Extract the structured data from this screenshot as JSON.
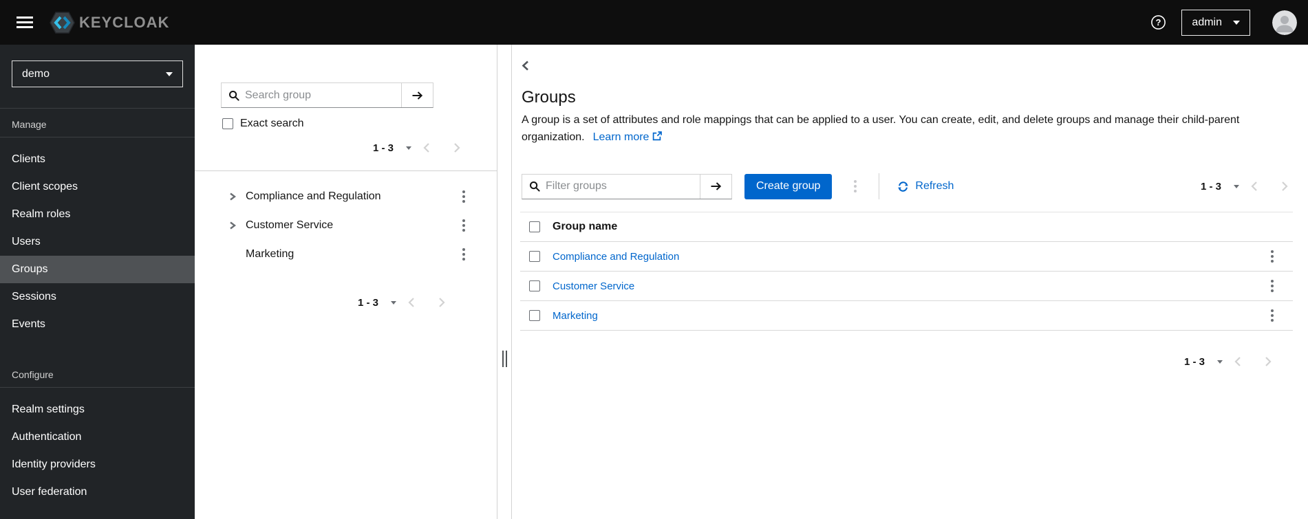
{
  "colors": {
    "accent": "#0066cc",
    "link": "#0066cc",
    "masthead_bg": "#0e0e0e",
    "sidebar_bg": "#212427",
    "sidebar_selected_bg": "#4f5255",
    "border": "#d2d2d2"
  },
  "icons": {
    "menu": "hamburger",
    "brand": "keycloak-hexagon-chevrons",
    "help": "question-circle",
    "user": "avatar-silhouette",
    "search": "magnifier",
    "go": "arrow-right",
    "expand": "chevron-right",
    "back": "chevron-left",
    "kebab": "three-dots-vertical",
    "refresh": "sync-arrows",
    "external": "external-link",
    "caret": "caret-down"
  },
  "masthead": {
    "brand": "KEYCLOAK",
    "user": "admin"
  },
  "sidebar": {
    "realm": "demo",
    "manage": {
      "label": "Manage",
      "items": [
        "Clients",
        "Client scopes",
        "Realm roles",
        "Users",
        "Groups",
        "Sessions",
        "Events"
      ]
    },
    "configure": {
      "label": "Configure",
      "items": [
        "Realm settings",
        "Authentication",
        "Identity providers",
        "User federation"
      ]
    },
    "selected_item": "Groups"
  },
  "tree": {
    "search_placeholder": "Search group",
    "exact_search": "Exact search",
    "pagination_top": "1 - 3",
    "pagination_bottom": "1 - 3",
    "items": [
      "Compliance and Regulation",
      "Customer Service",
      "Marketing"
    ]
  },
  "main": {
    "title": "Groups",
    "description": "A group is a set of attributes and role mappings that can be applied to a user. You can create, edit, and delete groups and manage their child-parent organization.",
    "learn_more": "Learn more",
    "toolbar": {
      "filter_placeholder": "Filter groups",
      "create_button": "Create group",
      "refresh": "Refresh",
      "pagination": "1 - 3"
    },
    "table": {
      "header": "Group name",
      "rows": [
        "Compliance and Regulation",
        "Customer Service",
        "Marketing"
      ]
    },
    "pagination_bottom": "1 - 3"
  }
}
